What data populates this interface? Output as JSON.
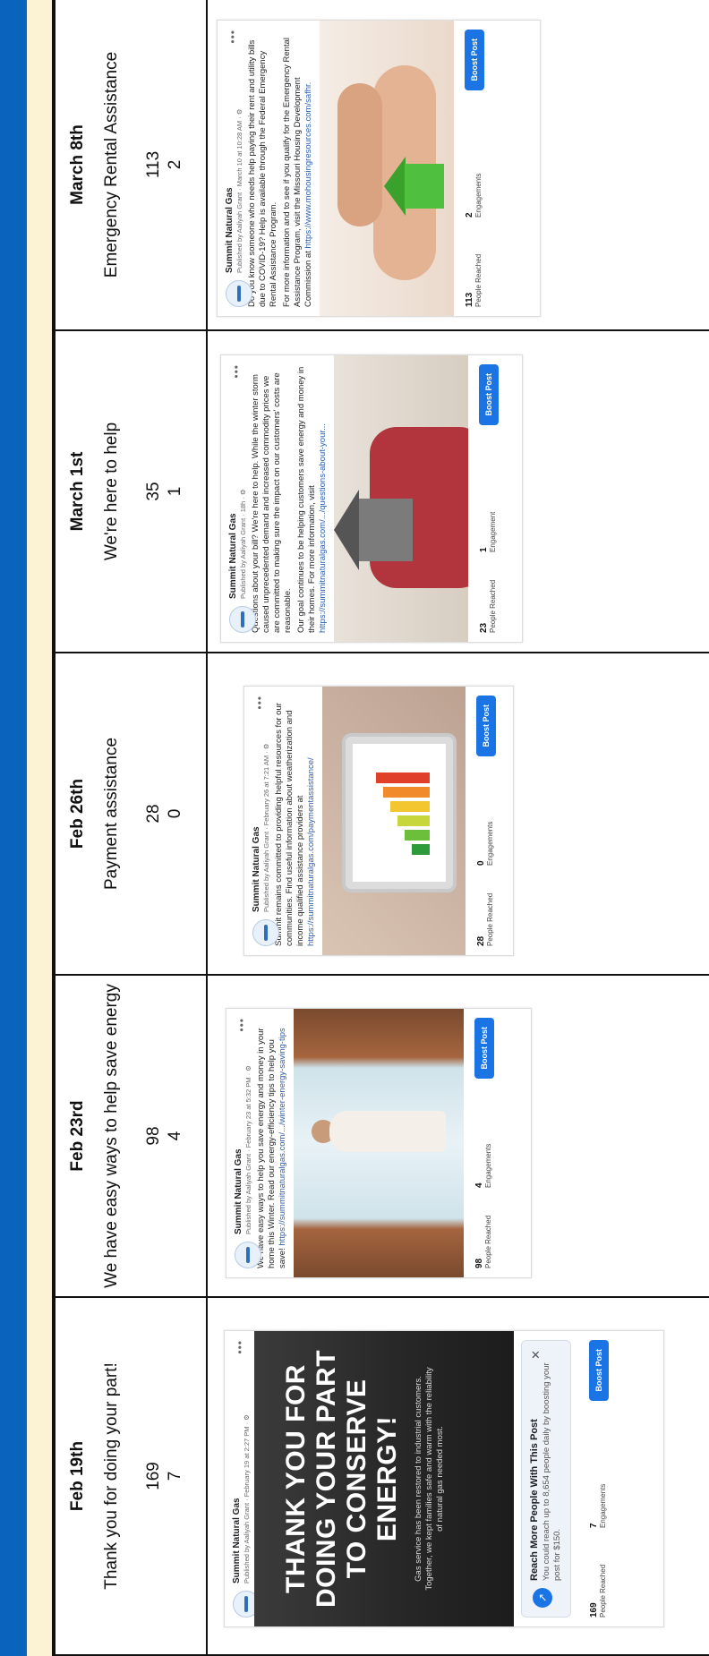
{
  "columns": [
    {
      "date": "Feb 19th",
      "title": "Thank you for doing your part!",
      "reached": "169",
      "engagements": "7"
    },
    {
      "date": "Feb 23rd",
      "title": "We have easy ways to help save energy",
      "reached": "98",
      "engagements": "4"
    },
    {
      "date": "Feb 26th",
      "title": "Payment assistance",
      "reached": "28",
      "engagements": "0"
    },
    {
      "date": "March 1st",
      "title": "We're here to help",
      "reached": "35",
      "engagements": "1"
    },
    {
      "date": "March 8th",
      "title": "Emergency Rental Assistance",
      "reached": "113",
      "engagements": "2"
    }
  ],
  "posts": [
    {
      "page": "Summit Natural Gas",
      "byline": "Published by Aaliyah Grant · February 19 at 2:27 PM · ⚙",
      "image_headline": "THANK YOU FOR DOING YOUR PART TO CONSERVE ENERGY!",
      "image_sub": "Gas service has been restored to industrial customers. Together, we kept families safe and warm with the reliability of natural gas needed most.",
      "reach_title": "Reach More People With This Post",
      "reach_body": "You could reach up to 8,654 people daily by boosting your post for $150.",
      "people_reached": "169",
      "people_label": "People Reached",
      "engagements": "7",
      "engagements_label": "Engagements",
      "boost": "Boost Post"
    },
    {
      "page": "Summit Natural Gas",
      "byline": "Published by Aaliyah Grant · February 23 at 5:32 PM · ⚙",
      "text": "We have easy ways to help you save energy and money in your home this Winter. Read our energy-efficiency tips to help you save!",
      "link": "https://summitnaturalgas.com/.../winter-energy-saving-tips",
      "people_reached": "98",
      "people_label": "People Reached",
      "engagements": "4",
      "engagements_label": "Engagements",
      "boost": "Boost Post"
    },
    {
      "page": "Summit Natural Gas",
      "byline": "Published by Aaliyah Grant · February 26 at 7:21 AM · ⚙",
      "text": "Summit remains committed to providing helpful resources for our communities. Find useful information about weatherization and income qualified assistance providers at",
      "link": "https://summitnaturalgas.com/paymentassistance/",
      "people_reached": "28",
      "people_label": "People Reached",
      "engagements": "0",
      "engagements_label": "Engagements",
      "boost": "Boost Post"
    },
    {
      "page": "Summit Natural Gas",
      "byline": "Published by Aaliyah Grant · 18h · ⚙",
      "text": "Questions about your bill? We're here to help. While the winter storm caused unprecedented demand and increased commodity prices we are committed to making sure the impact on our customers' costs are reasonable.",
      "text2": "Our goal continues to be helping customers save energy and money in their homes. For more information, visit",
      "link": "https://summitnaturalgas.com/.../questions-about-your...",
      "people_reached": "23",
      "people_label": "People Reached",
      "engagements": "1",
      "engagements_label": "Engagement",
      "boost": "Boost Post"
    },
    {
      "page": "Summit Natural Gas",
      "byline": "Published by Aaliyah Grant · March 10 at 10:28 AM · ⚙",
      "text": "Do you know someone who needs help paying their rent and utility bills due to COVID-19? Help is available through the Federal Emergency Rental Assistance Program.",
      "text2": "For more information and to see if you qualify for the Emergency Rental Assistance Program, visit the Missouri Housing Development Commission at",
      "link": "https://www.mohousingresources.com/safhr.",
      "people_reached": "113",
      "people_label": "People Reached",
      "engagements": "2",
      "engagements_label": "Engagements",
      "boost": "Boost Post"
    }
  ],
  "colors": {
    "blue_bar": "#0a63bd",
    "cream_bar": "#fcf3d4",
    "boost": "#1b74e4",
    "link": "#2a5db0"
  }
}
